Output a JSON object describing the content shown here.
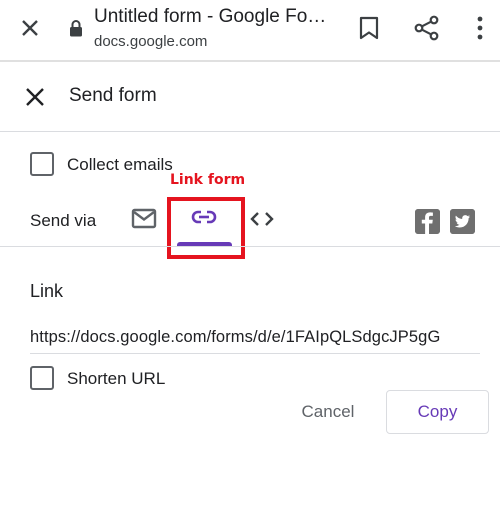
{
  "browser": {
    "page_title": "Untitled form - Google Fo…",
    "url": "docs.google.com"
  },
  "dialog": {
    "title": "Send form",
    "collect_emails_label": "Collect emails",
    "collect_emails_checked": false,
    "send_via_label": "Send via",
    "tabs": [
      {
        "name": "email",
        "icon": "mail-icon",
        "selected": false
      },
      {
        "name": "link",
        "icon": "link-icon",
        "selected": true
      },
      {
        "name": "embed",
        "icon": "code-icon",
        "selected": false
      }
    ],
    "social": [
      {
        "name": "facebook",
        "icon": "facebook-icon"
      },
      {
        "name": "twitter",
        "icon": "twitter-icon"
      }
    ],
    "link_heading": "Link",
    "link_value": "https://docs.google.com/forms/d/e/1FAIpQLSdgcJP5gG",
    "shorten_url_label": "Shorten URL",
    "shorten_url_checked": false,
    "cancel_label": "Cancel",
    "copy_label": "Copy"
  },
  "annotation": {
    "label": "Link form"
  },
  "colors": {
    "accent": "#673ab7",
    "annotation": "#e5141f",
    "icon_gray": "#5f6368"
  }
}
